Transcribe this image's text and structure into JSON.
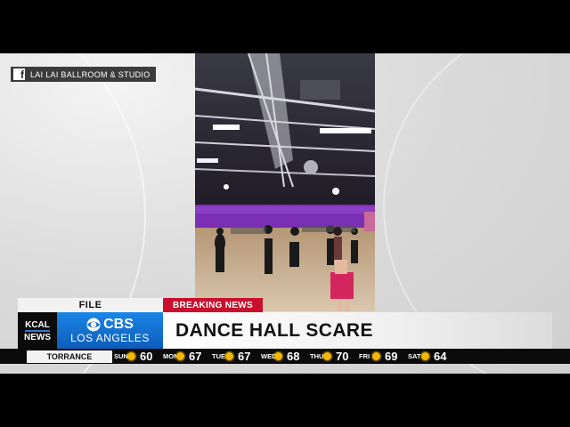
{
  "credit": {
    "platform_icon": "facebook-icon",
    "source": "LAI LAI BALLROOM & STUDIO"
  },
  "lower_third": {
    "tag": "FILE",
    "station_short": "KCAL",
    "station_short2": "NEWS",
    "network": "CBS",
    "network_sub": "LOS ANGELES",
    "breaking_label": "BREAKING NEWS",
    "headline": "DANCE HALL SCARE"
  },
  "weather": {
    "city": "TORRANCE",
    "days": [
      {
        "day": "SUN",
        "temp": "60",
        "icon": "sun-icon"
      },
      {
        "day": "MON",
        "temp": "67",
        "icon": "sun-icon"
      },
      {
        "day": "TUE",
        "temp": "67",
        "icon": "sun-icon"
      },
      {
        "day": "WED",
        "temp": "68",
        "icon": "sun-icon"
      },
      {
        "day": "THU",
        "temp": "70",
        "icon": "sun-icon"
      },
      {
        "day": "FRI",
        "temp": "69",
        "icon": "sun-icon"
      },
      {
        "day": "SAT",
        "temp": "64",
        "icon": "sun-icon"
      }
    ]
  },
  "colors": {
    "breaking": "#c8102e",
    "cbs_blue": "#1a86e6",
    "sun": "#f5b800"
  }
}
